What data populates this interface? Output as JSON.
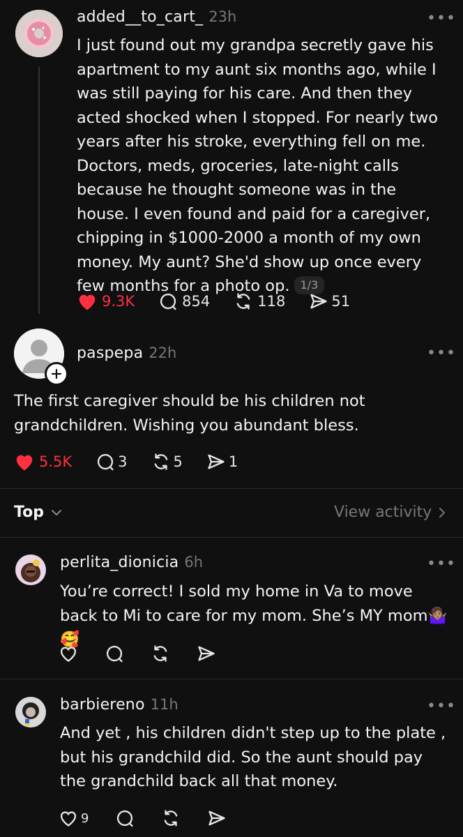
{
  "post": {
    "username": "added__to_cart_",
    "time": "23h",
    "more": "•••",
    "text": "I just found out my grandpa secretly gave his apartment to my aunt six months ago, while I was still paying for his care. And then they acted shocked when I stopped. For nearly two years after his stroke, everything fell on me. Doctors, meds, groceries, late-night calls because he thought someone was in the house. I even found and paid for a caregiver, chipping in $1000-2000 a month of my own money. My aunt? She'd show up once every few months for a photo op.",
    "pager": "1/3",
    "likes": "9.3K",
    "replies": "854",
    "reposts": "118",
    "shares": "51"
  },
  "reply": {
    "username": "paspepa",
    "time": "22h",
    "more": "•••",
    "text": "The first caregiver should be his children not grandchildren. Wishing you abundant bless.",
    "likes": "5.5K",
    "replies": "3",
    "reposts": "5",
    "shares": "1"
  },
  "sort": {
    "label": "Top",
    "view_activity": "View activity"
  },
  "comments": [
    {
      "username": "perlita_dionicia",
      "time": "6h",
      "more": "•••",
      "text": "You’re correct! I sold my home in Va to move back to Mi to care for my mom. She’s MY mom🤷🏽‍♀️🥰"
    },
    {
      "username": "barbiereno",
      "time": "11h",
      "more": "•••",
      "text": "And yet , his children didn't step up to the plate , but his grandchild did. So the aunt should pay the grandchild back all that money.",
      "likes": "9"
    }
  ],
  "icons": {
    "like": "heart-icon",
    "reply": "comment-bubble-icon",
    "repost": "repost-arrows-icon",
    "share": "send-icon",
    "follow": "plus-icon",
    "chevron": "chevron-down-icon",
    "chevron_right": "chevron-right-icon"
  },
  "colors": {
    "background": "#101010",
    "text": "#f3f5f7",
    "muted": "#777777",
    "like_red": "#ff3040",
    "divider": "#2a2a2a"
  }
}
